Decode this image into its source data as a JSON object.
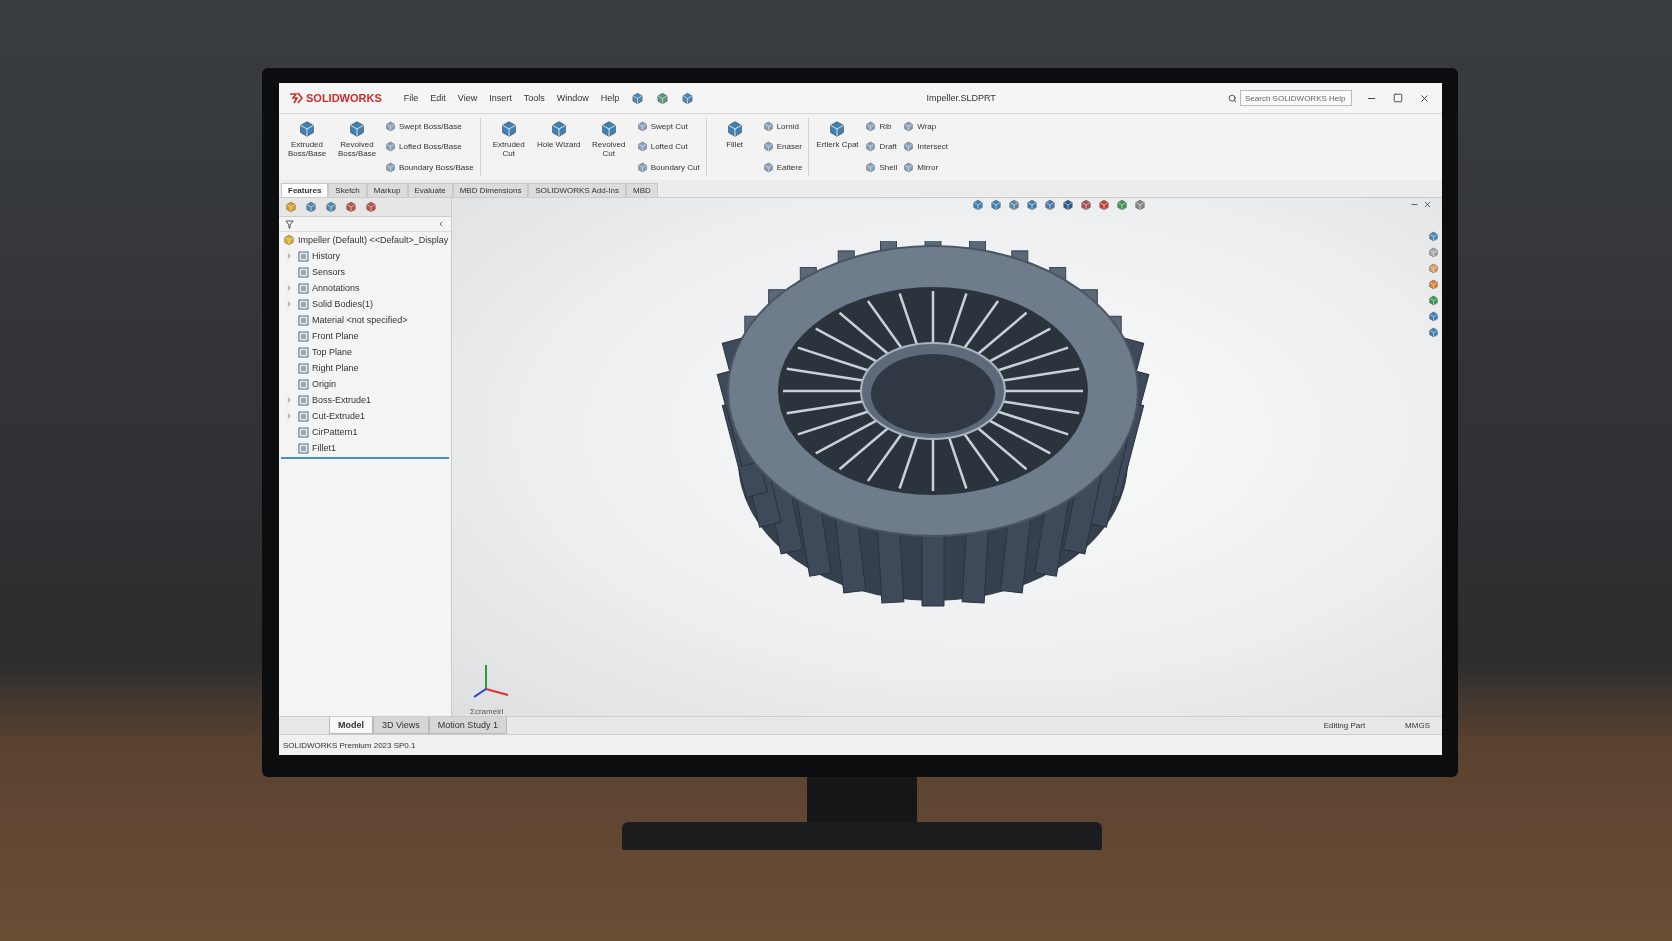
{
  "app": {
    "logo": "SOLIDWORKS",
    "menu": [
      "File",
      "Edit",
      "View",
      "Insert",
      "Tools",
      "Window",
      "Help"
    ],
    "title": "Impeller.SLDPRT",
    "search": {
      "placeholder": "Search SOLIDWORKS Help"
    }
  },
  "ribbon": [
    {
      "kind": "large",
      "label": "Extruded Boss/Base"
    },
    {
      "kind": "large",
      "label": "Revolved Boss/Base"
    },
    {
      "kind": "stack",
      "items": [
        "Swept Boss/Base",
        "Lofted Boss/Base",
        "Boundary Boss/Base"
      ]
    },
    {
      "kind": "separator"
    },
    {
      "kind": "large",
      "label": "Extruded Cut"
    },
    {
      "kind": "large",
      "label": "Hole Wizard"
    },
    {
      "kind": "large",
      "label": "Revolved Cut"
    },
    {
      "kind": "stack",
      "items": [
        "Swept Cut",
        "Lofted Cut",
        "Boundary Cut"
      ]
    },
    {
      "kind": "separator"
    },
    {
      "kind": "large",
      "label": "Fillet"
    },
    {
      "kind": "stack",
      "items": [
        "Lornid",
        "Enaser",
        "Eattere"
      ]
    },
    {
      "kind": "separator"
    },
    {
      "kind": "large",
      "label": "Ertlerk Cpat"
    },
    {
      "kind": "stack",
      "items": [
        "Rib",
        "Draft",
        "Shell"
      ]
    },
    {
      "kind": "stack",
      "items": [
        "Wrap",
        "Intersect",
        "Mirror"
      ]
    }
  ],
  "tabs": [
    {
      "label": "Features",
      "selected": true
    },
    {
      "label": "Sketch",
      "selected": false
    },
    {
      "label": "Markup",
      "selected": false
    },
    {
      "label": "Evaluate",
      "selected": false
    },
    {
      "label": "MBD Dimensions",
      "selected": false
    },
    {
      "label": "SOLIDWORKS Add-Ins",
      "selected": false
    },
    {
      "label": "MBD",
      "selected": false
    }
  ],
  "tree": {
    "label": "Impeller  (Default) <<Default>_Display",
    "children": [
      {
        "label": "History",
        "expandable": true
      },
      {
        "label": "Sensors",
        "expandable": false
      },
      {
        "label": "Annotations",
        "expandable": true
      },
      {
        "label": "Solid Bodies(1)",
        "expandable": true
      },
      {
        "label": "Material <not specified>",
        "expandable": false
      },
      {
        "label": "Front Plane",
        "expandable": false
      },
      {
        "label": "Top Plane",
        "expandable": false
      },
      {
        "label": "Right Plane",
        "expandable": false
      },
      {
        "label": "Origin",
        "expandable": false
      },
      {
        "label": "Boss-Extrude1",
        "expandable": true
      },
      {
        "label": "Cut-Extrude1",
        "expandable": true
      },
      {
        "label": "CirPattern1",
        "expandable": false
      },
      {
        "label": "Fillet1",
        "expandable": false
      }
    ]
  },
  "viewport": {
    "view_label": "Σcrameiri"
  },
  "bottom_tabs": [
    {
      "label": "Model",
      "selected": true
    },
    {
      "label": "3D Views",
      "selected": false
    },
    {
      "label": "Motion Study 1",
      "selected": false
    }
  ],
  "status_bar": {
    "version": "SOLIDWORKS Premium 2023 SP0.1",
    "mode": "Editing Part",
    "units": "MMGS"
  }
}
